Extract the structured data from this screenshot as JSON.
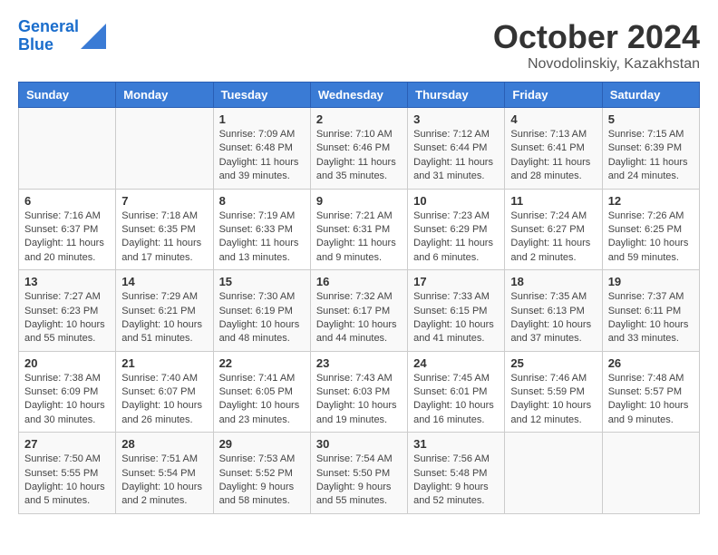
{
  "header": {
    "logo_line1": "General",
    "logo_line2": "Blue",
    "title": "October 2024",
    "location": "Novodolinskiy, Kazakhstan"
  },
  "weekdays": [
    "Sunday",
    "Monday",
    "Tuesday",
    "Wednesday",
    "Thursday",
    "Friday",
    "Saturday"
  ],
  "weeks": [
    [
      {
        "day": "",
        "info": ""
      },
      {
        "day": "",
        "info": ""
      },
      {
        "day": "1",
        "info": "Sunrise: 7:09 AM\nSunset: 6:48 PM\nDaylight: 11 hours and 39 minutes."
      },
      {
        "day": "2",
        "info": "Sunrise: 7:10 AM\nSunset: 6:46 PM\nDaylight: 11 hours and 35 minutes."
      },
      {
        "day": "3",
        "info": "Sunrise: 7:12 AM\nSunset: 6:44 PM\nDaylight: 11 hours and 31 minutes."
      },
      {
        "day": "4",
        "info": "Sunrise: 7:13 AM\nSunset: 6:41 PM\nDaylight: 11 hours and 28 minutes."
      },
      {
        "day": "5",
        "info": "Sunrise: 7:15 AM\nSunset: 6:39 PM\nDaylight: 11 hours and 24 minutes."
      }
    ],
    [
      {
        "day": "6",
        "info": "Sunrise: 7:16 AM\nSunset: 6:37 PM\nDaylight: 11 hours and 20 minutes."
      },
      {
        "day": "7",
        "info": "Sunrise: 7:18 AM\nSunset: 6:35 PM\nDaylight: 11 hours and 17 minutes."
      },
      {
        "day": "8",
        "info": "Sunrise: 7:19 AM\nSunset: 6:33 PM\nDaylight: 11 hours and 13 minutes."
      },
      {
        "day": "9",
        "info": "Sunrise: 7:21 AM\nSunset: 6:31 PM\nDaylight: 11 hours and 9 minutes."
      },
      {
        "day": "10",
        "info": "Sunrise: 7:23 AM\nSunset: 6:29 PM\nDaylight: 11 hours and 6 minutes."
      },
      {
        "day": "11",
        "info": "Sunrise: 7:24 AM\nSunset: 6:27 PM\nDaylight: 11 hours and 2 minutes."
      },
      {
        "day": "12",
        "info": "Sunrise: 7:26 AM\nSunset: 6:25 PM\nDaylight: 10 hours and 59 minutes."
      }
    ],
    [
      {
        "day": "13",
        "info": "Sunrise: 7:27 AM\nSunset: 6:23 PM\nDaylight: 10 hours and 55 minutes."
      },
      {
        "day": "14",
        "info": "Sunrise: 7:29 AM\nSunset: 6:21 PM\nDaylight: 10 hours and 51 minutes."
      },
      {
        "day": "15",
        "info": "Sunrise: 7:30 AM\nSunset: 6:19 PM\nDaylight: 10 hours and 48 minutes."
      },
      {
        "day": "16",
        "info": "Sunrise: 7:32 AM\nSunset: 6:17 PM\nDaylight: 10 hours and 44 minutes."
      },
      {
        "day": "17",
        "info": "Sunrise: 7:33 AM\nSunset: 6:15 PM\nDaylight: 10 hours and 41 minutes."
      },
      {
        "day": "18",
        "info": "Sunrise: 7:35 AM\nSunset: 6:13 PM\nDaylight: 10 hours and 37 minutes."
      },
      {
        "day": "19",
        "info": "Sunrise: 7:37 AM\nSunset: 6:11 PM\nDaylight: 10 hours and 33 minutes."
      }
    ],
    [
      {
        "day": "20",
        "info": "Sunrise: 7:38 AM\nSunset: 6:09 PM\nDaylight: 10 hours and 30 minutes."
      },
      {
        "day": "21",
        "info": "Sunrise: 7:40 AM\nSunset: 6:07 PM\nDaylight: 10 hours and 26 minutes."
      },
      {
        "day": "22",
        "info": "Sunrise: 7:41 AM\nSunset: 6:05 PM\nDaylight: 10 hours and 23 minutes."
      },
      {
        "day": "23",
        "info": "Sunrise: 7:43 AM\nSunset: 6:03 PM\nDaylight: 10 hours and 19 minutes."
      },
      {
        "day": "24",
        "info": "Sunrise: 7:45 AM\nSunset: 6:01 PM\nDaylight: 10 hours and 16 minutes."
      },
      {
        "day": "25",
        "info": "Sunrise: 7:46 AM\nSunset: 5:59 PM\nDaylight: 10 hours and 12 minutes."
      },
      {
        "day": "26",
        "info": "Sunrise: 7:48 AM\nSunset: 5:57 PM\nDaylight: 10 hours and 9 minutes."
      }
    ],
    [
      {
        "day": "27",
        "info": "Sunrise: 7:50 AM\nSunset: 5:55 PM\nDaylight: 10 hours and 5 minutes."
      },
      {
        "day": "28",
        "info": "Sunrise: 7:51 AM\nSunset: 5:54 PM\nDaylight: 10 hours and 2 minutes."
      },
      {
        "day": "29",
        "info": "Sunrise: 7:53 AM\nSunset: 5:52 PM\nDaylight: 9 hours and 58 minutes."
      },
      {
        "day": "30",
        "info": "Sunrise: 7:54 AM\nSunset: 5:50 PM\nDaylight: 9 hours and 55 minutes."
      },
      {
        "day": "31",
        "info": "Sunrise: 7:56 AM\nSunset: 5:48 PM\nDaylight: 9 hours and 52 minutes."
      },
      {
        "day": "",
        "info": ""
      },
      {
        "day": "",
        "info": ""
      }
    ]
  ]
}
